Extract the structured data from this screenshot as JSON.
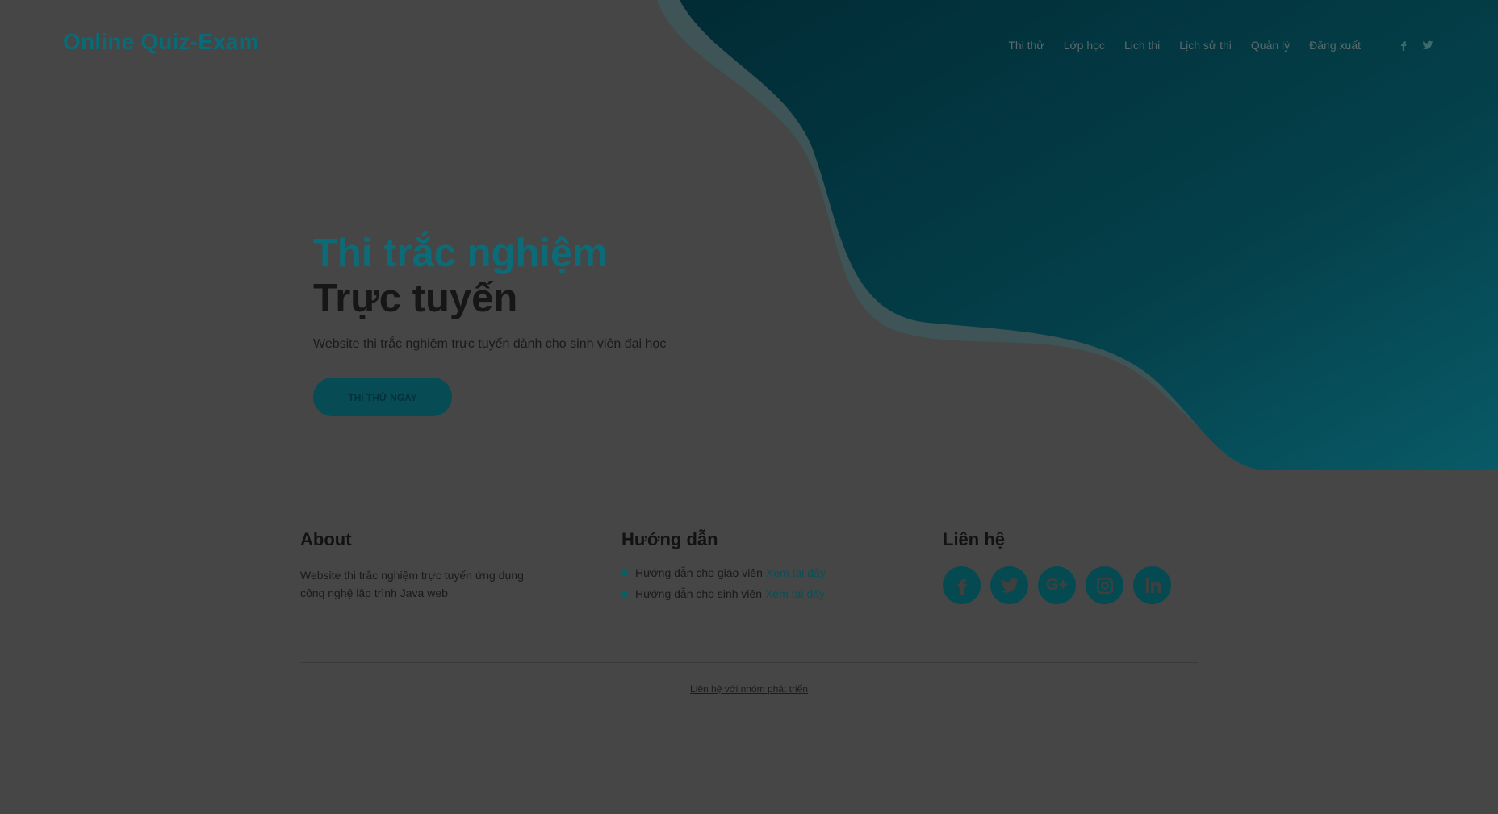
{
  "brand": {
    "name": "Online Quiz-Exam",
    "accent": "#0a6a75"
  },
  "nav": {
    "items": [
      {
        "label": "Thi thử"
      },
      {
        "label": "Lớp học"
      },
      {
        "label": "Lịch thi"
      },
      {
        "label": "Lịch sử thi"
      },
      {
        "label": "Quản lý"
      },
      {
        "label": "Đăng xuất"
      }
    ],
    "social_icons": [
      "facebook-icon",
      "twitter-icon"
    ]
  },
  "hero": {
    "title_line1": "Thi trắc nghiệm",
    "title_line2": "Trực tuyến",
    "subtitle": "Website thi trắc nghiệm trực tuyến dành cho sinh viên đại học",
    "cta_label": "THI THỬ NGAY"
  },
  "footer": {
    "about": {
      "title": "About",
      "text": "Website thi trắc nghiệm trực tuyến ứng dụng công nghệ lập trình Java web"
    },
    "guide": {
      "title": "Hướng dẫn",
      "items": [
        {
          "text": "Hướng dẫn cho giáo viên",
          "link": "Xem tại đây"
        },
        {
          "text": "Hướng dẫn cho sinh viên",
          "link": "Xem tại đây"
        }
      ]
    },
    "contact": {
      "title": "Liên hệ",
      "icons": [
        "facebook-icon",
        "twitter-icon",
        "google-plus-icon",
        "instagram-icon",
        "linkedin-icon"
      ]
    },
    "bottom_link": "Liên hệ với nhóm phát triển"
  }
}
